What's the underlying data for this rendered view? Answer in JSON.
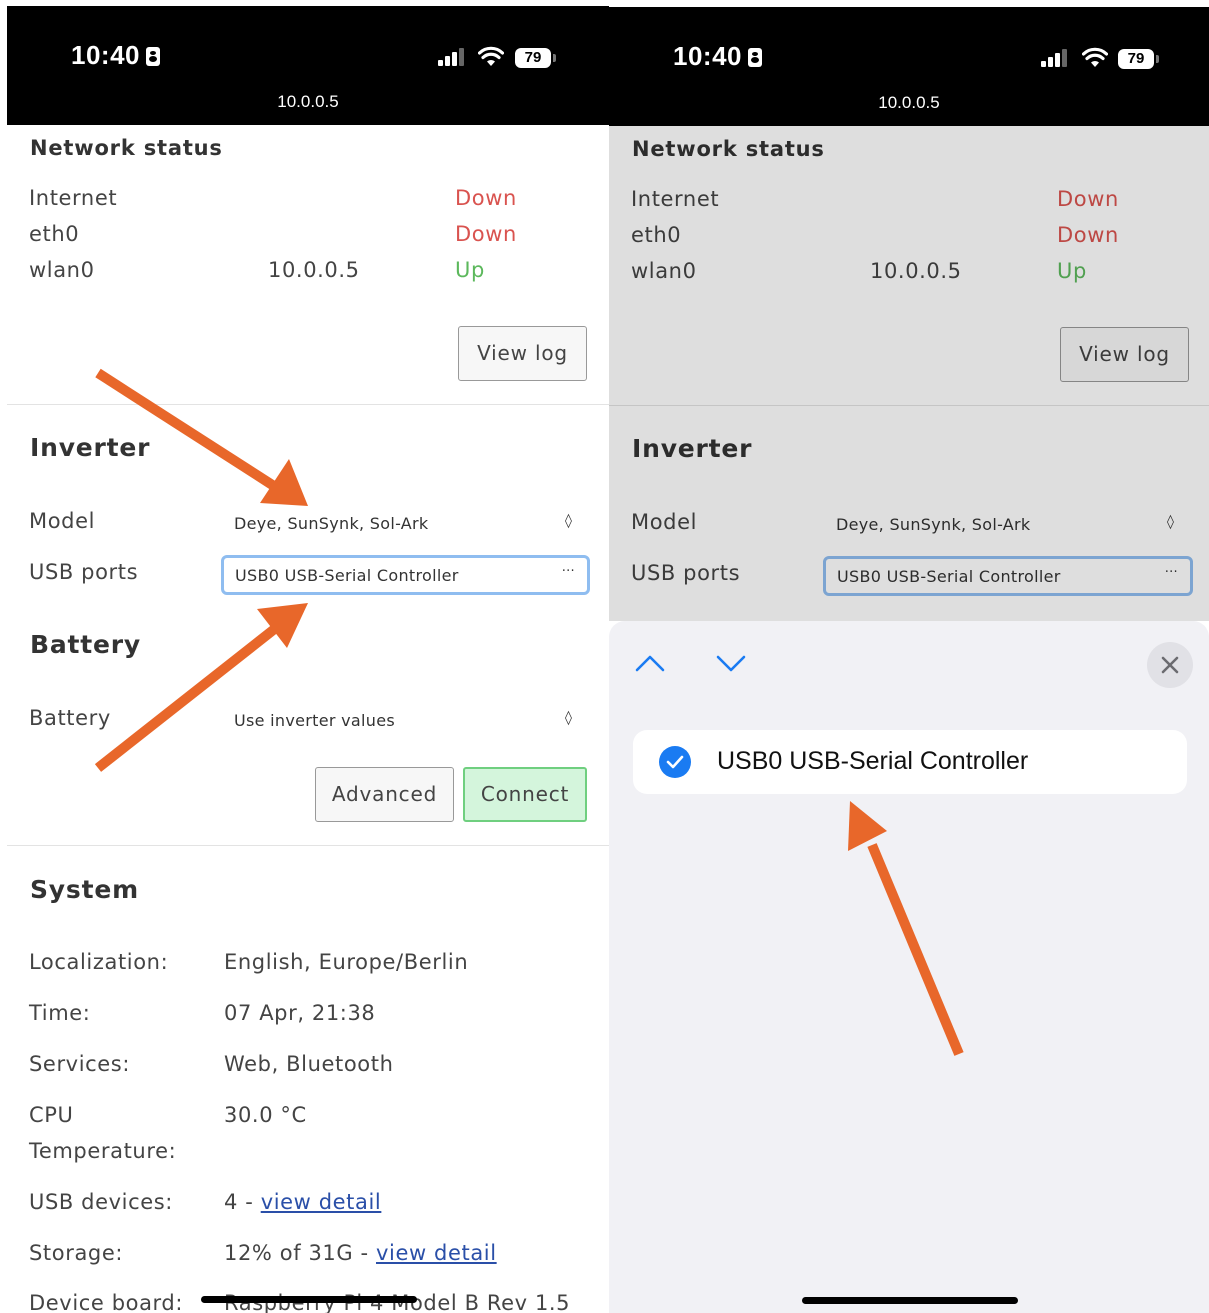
{
  "status_bar": {
    "time": "10:40",
    "battery": "79",
    "url": "10.0.0.5"
  },
  "network": {
    "title": "Network status",
    "rows": [
      {
        "label": "Internet",
        "ip": "",
        "state": "Down"
      },
      {
        "label": "eth0",
        "ip": "",
        "state": "Down"
      },
      {
        "label": "wlan0",
        "ip": "10.0.0.5",
        "state": "Up"
      }
    ],
    "view_log": "View log"
  },
  "inverter": {
    "title": "Inverter",
    "model_label": "Model",
    "model_value": "Deye, SunSynk, Sol-Ark",
    "usb_label": "USB ports",
    "usb_value": "USB0 USB-Serial Controller",
    "ellipsis": "···"
  },
  "battery": {
    "title": "Battery",
    "label": "Battery",
    "value": "Use inverter values",
    "advanced": "Advanced",
    "connect": "Connect"
  },
  "system": {
    "title": "System",
    "localization_label": "Localization:",
    "localization_value": "English, Europe/Berlin",
    "time_label": "Time:",
    "time_value": "07 Apr, 21:38",
    "services_label": "Services:",
    "services_value": "Web, Bluetooth",
    "cpu_label_1": "CPU",
    "cpu_label_2": "Temperature:",
    "cpu_value": "30.0 °C",
    "usb_label": "USB devices:",
    "usb_count": "4 - ",
    "usb_link": "view detail",
    "storage_label": "Storage:",
    "storage_value": "12% of 31G - ",
    "storage_link": "view detail",
    "board_label": "Device board:",
    "board_value": "Raspberry Pi 4 Model B Rev 1.5"
  },
  "picker": {
    "option": "USB0 USB-Serial Controller",
    "selected": true
  },
  "colors": {
    "down": "#d9534f",
    "up": "#5cb85c",
    "annotation_arrow": "#e8672a",
    "checkmark": "#1a7bf2"
  }
}
